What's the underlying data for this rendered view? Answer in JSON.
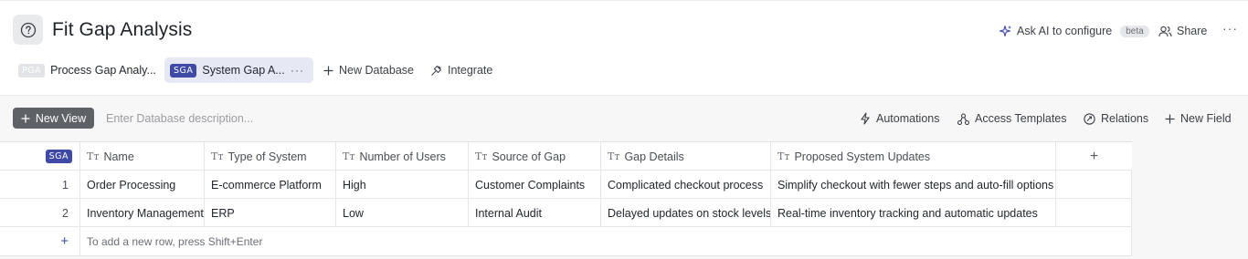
{
  "page": {
    "title": "Fit Gap Analysis",
    "icon": "help-circle-icon"
  },
  "top_actions": {
    "ask_ai_label": "Ask AI to configure",
    "beta_label": "beta",
    "share_label": "Share",
    "more_label": "···"
  },
  "tabs": [
    {
      "badge": "PGA",
      "label": "Process Gap Analy...",
      "active": false
    },
    {
      "badge": "SGA",
      "label": "System Gap A...",
      "active": true,
      "more": "···"
    }
  ],
  "tab_actions": {
    "new_database_label": "New Database",
    "integrate_label": "Integrate"
  },
  "toolbar": {
    "new_view_label": "New View",
    "description_placeholder": "Enter Database description...",
    "automations_label": "Automations",
    "access_templates_label": "Access Templates",
    "relations_label": "Relations",
    "new_field_label": "New Field"
  },
  "table": {
    "badge": "SGA",
    "type_glyph": "Tт",
    "columns": [
      "Name",
      "Type of System",
      "Number of Users",
      "Source of Gap",
      "Gap Details",
      "Proposed System Updates"
    ],
    "rows": [
      {
        "index": "1",
        "cells": [
          "Order Processing",
          "E-commerce Platform",
          "High",
          "Customer Complaints",
          "Complicated checkout process",
          "Simplify checkout with fewer steps and auto-fill options"
        ]
      },
      {
        "index": "2",
        "cells": [
          "Inventory Management",
          "ERP",
          "Low",
          "Internal Audit",
          "Delayed updates on stock levels",
          "Real-time inventory tracking and automatic updates"
        ]
      }
    ],
    "add_row_hint": "To add a new row, press Shift+Enter",
    "add_column_label": "+",
    "add_row_label": "+"
  },
  "colors": {
    "accent": "#3e4aa6",
    "new_view_bg": "#5e6166",
    "active_tab_bg": "#e6e8f4"
  }
}
